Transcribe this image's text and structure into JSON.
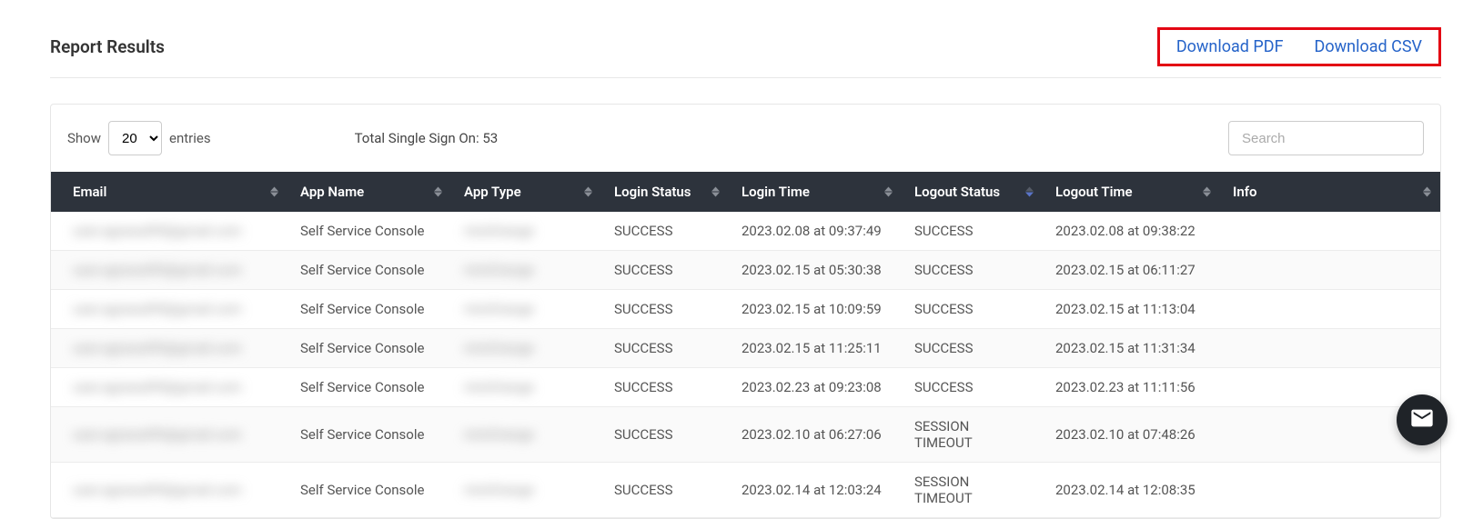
{
  "header": {
    "title": "Report Results",
    "download_pdf": "Download PDF",
    "download_csv": "Download CSV"
  },
  "controls": {
    "show_label": "Show",
    "entries_label": "entries",
    "page_size": "20",
    "total_label": "Total Single Sign On: 53",
    "search_placeholder": "Search"
  },
  "columns": {
    "email": "Email",
    "app_name": "App Name",
    "app_type": "App Type",
    "login_status": "Login Status",
    "login_time": "Login Time",
    "logout_status": "Logout Status",
    "logout_time": "Logout Time",
    "info": "Info"
  },
  "rows": [
    {
      "email": "user.agrawal99@gmail.com",
      "app_name": "Self Service Console",
      "app_type": "miniOrange",
      "login_status": "SUCCESS",
      "login_time": "2023.02.08 at 09:37:49",
      "logout_status": "SUCCESS",
      "logout_time": "2023.02.08 at 09:38:22",
      "info": ""
    },
    {
      "email": "user.agrawal99@gmail.com",
      "app_name": "Self Service Console",
      "app_type": "miniOrange",
      "login_status": "SUCCESS",
      "login_time": "2023.02.15 at 05:30:38",
      "logout_status": "SUCCESS",
      "logout_time": "2023.02.15 at 06:11:27",
      "info": ""
    },
    {
      "email": "user.agrawal99@gmail.com",
      "app_name": "Self Service Console",
      "app_type": "miniOrange",
      "login_status": "SUCCESS",
      "login_time": "2023.02.15 at 10:09:59",
      "logout_status": "SUCCESS",
      "logout_time": "2023.02.15 at 11:13:04",
      "info": ""
    },
    {
      "email": "user.agrawal99@gmail.com",
      "app_name": "Self Service Console",
      "app_type": "miniOrange",
      "login_status": "SUCCESS",
      "login_time": "2023.02.15 at 11:25:11",
      "logout_status": "SUCCESS",
      "logout_time": "2023.02.15 at 11:31:34",
      "info": ""
    },
    {
      "email": "user.agrawal99@gmail.com",
      "app_name": "Self Service Console",
      "app_type": "miniOrange",
      "login_status": "SUCCESS",
      "login_time": "2023.02.23 at 09:23:08",
      "logout_status": "SUCCESS",
      "logout_time": "2023.02.23 at 11:11:56",
      "info": ""
    },
    {
      "email": "user.agrawal99@gmail.com",
      "app_name": "Self Service Console",
      "app_type": "miniOrange",
      "login_status": "SUCCESS",
      "login_time": "2023.02.10 at 06:27:06",
      "logout_status": "SESSION TIMEOUT",
      "logout_time": "2023.02.10 at 07:48:26",
      "info": ""
    },
    {
      "email": "user.agrawal99@gmail.com",
      "app_name": "Self Service Console",
      "app_type": "miniOrange",
      "login_status": "SUCCESS",
      "login_time": "2023.02.14 at 12:03:24",
      "logout_status": "SESSION TIMEOUT",
      "logout_time": "2023.02.14 at 12:08:35",
      "info": ""
    }
  ]
}
